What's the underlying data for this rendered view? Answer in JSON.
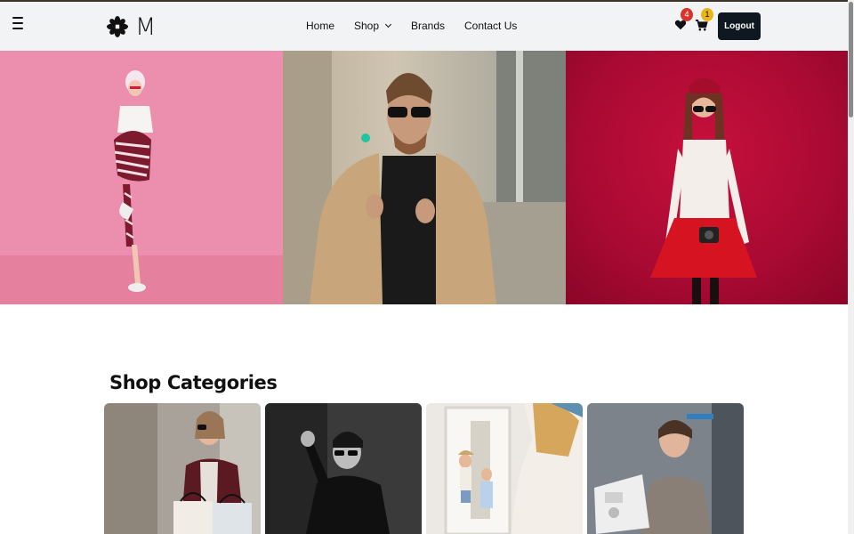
{
  "navbar": {
    "logo_letter": "M",
    "menu": [
      "Home",
      "Shop",
      "Brands",
      "Contact Us"
    ],
    "wishlist_count": "4",
    "cart_count": "1",
    "logout_label": "Logout"
  },
  "hero": {
    "panels": [
      {
        "name": "woman-pink-background",
        "background": "#ec8fae"
      },
      {
        "name": "man-beige-coat-street",
        "background": "#b9ae98"
      },
      {
        "name": "woman-red-skirt-red-background",
        "background": "#c6103c"
      }
    ]
  },
  "categories": {
    "title": "Shop Categories",
    "cards": [
      {
        "name": "category-woman-shopping-bags"
      },
      {
        "name": "category-man-black-and-white"
      },
      {
        "name": "category-woman-mirror"
      },
      {
        "name": "category-woman-sewing"
      }
    ]
  },
  "colors": {
    "navbar_bg": "#f2f3f5",
    "logout_bg": "#0f1720",
    "badge_red": "#d9342b",
    "badge_yellow": "#e8b51a"
  },
  "icons": [
    "hamburger-icon",
    "flower-logo-icon",
    "chevron-down-icon",
    "heart-icon",
    "cart-icon"
  ]
}
